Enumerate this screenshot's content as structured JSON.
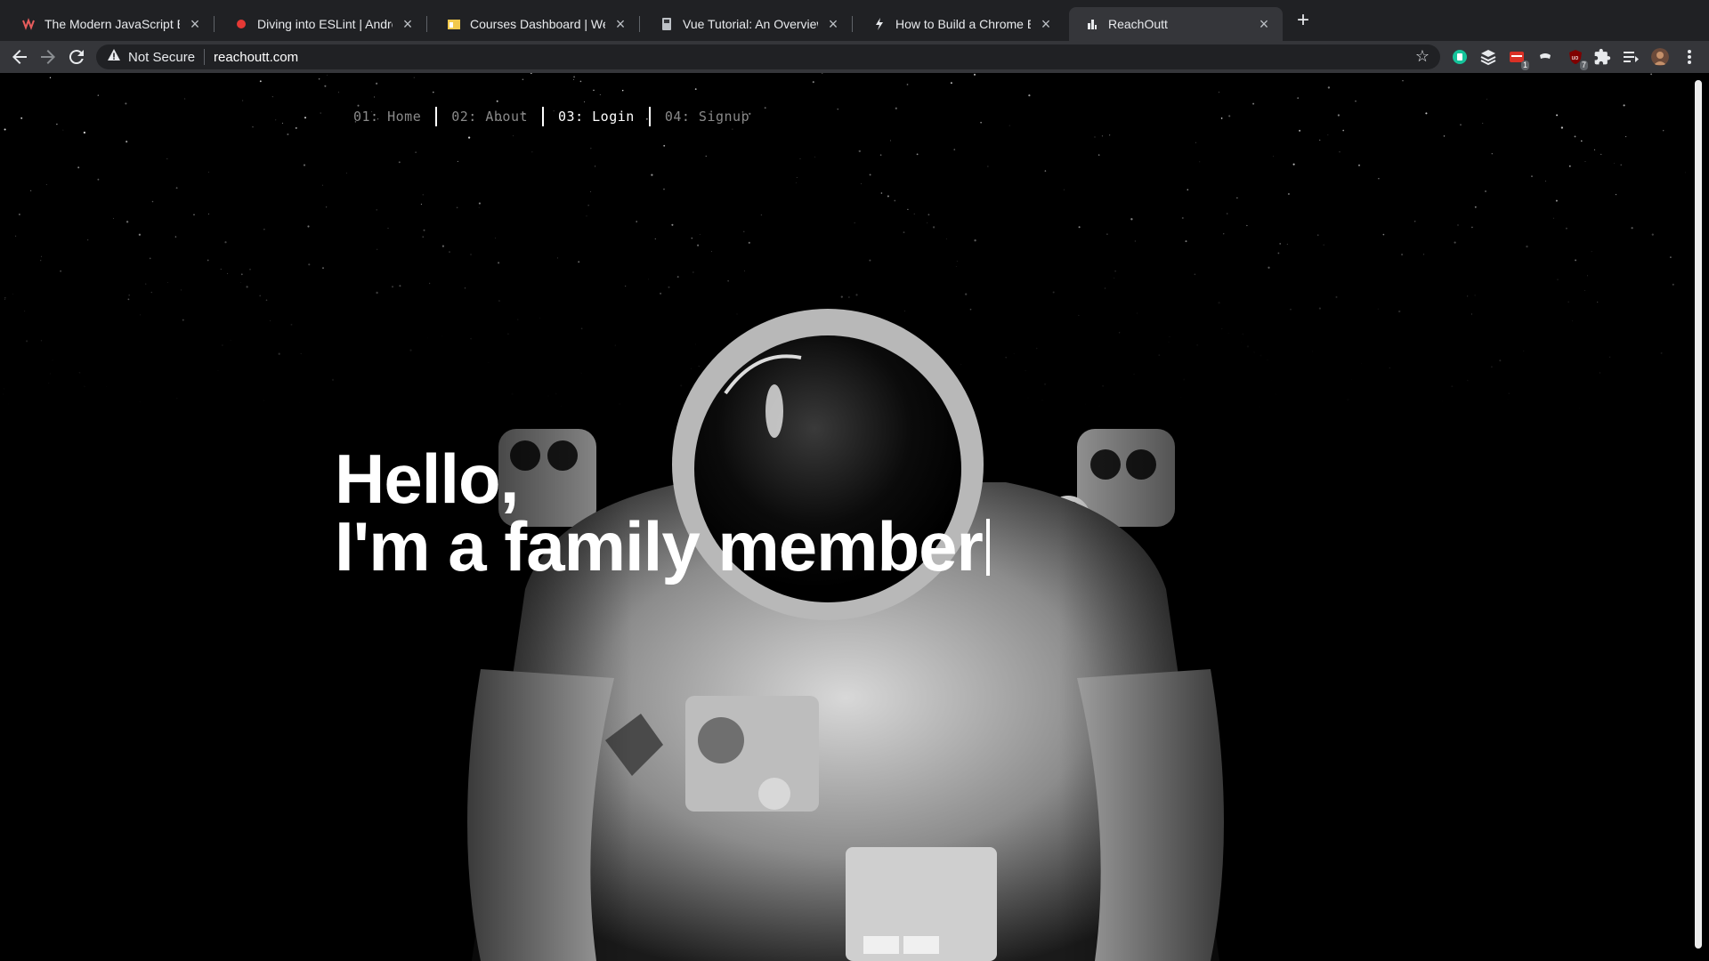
{
  "browser": {
    "tabs": [
      {
        "title": "The Modern JavaScript Bootcamp",
        "icon": "udemy-icon",
        "color": "#a435f0"
      },
      {
        "title": "Diving into ESLint | Andrew Mead",
        "icon": "red-dot-icon",
        "color": "#e53935"
      },
      {
        "title": "Courses Dashboard | Wes Bos",
        "icon": "wesbos-icon",
        "color": "#f2c94c"
      },
      {
        "title": "Vue Tutorial: An Overview and Walkthrough",
        "icon": "bookmark-icon",
        "color": "#9aa0a6"
      },
      {
        "title": "How to Build a Chrome Extension",
        "icon": "lightning-icon",
        "color": "#e8eaed"
      },
      {
        "title": "ReachOutt",
        "icon": "reachoutt-icon",
        "color": "#e8eaed"
      }
    ],
    "active_tab": 5,
    "security_label": "Not Secure",
    "url": "reachoutt.com",
    "extensions": [
      {
        "name": "grammarly-icon",
        "color": "#15c39a"
      },
      {
        "name": "layers-icon",
        "color": "#e8eaed"
      },
      {
        "name": "calendar-icon",
        "color": "#d93025",
        "badge": "1"
      },
      {
        "name": "mask-icon",
        "color": "#e8eaed"
      },
      {
        "name": "ublock-icon",
        "color": "#800000",
        "badge": "7"
      },
      {
        "name": "puzzle-icon",
        "color": "#e8eaed"
      },
      {
        "name": "reading-list-icon",
        "color": "#e8eaed"
      },
      {
        "name": "profile-avatar",
        "color": "#b07a5a"
      }
    ]
  },
  "site": {
    "nav": [
      {
        "label": "01: Home"
      },
      {
        "label": "02: About"
      },
      {
        "label": "03: Login"
      },
      {
        "label": "04: Signup"
      }
    ],
    "active_nav": 2,
    "hero": {
      "line1": "Hello,",
      "line2": "I'm a family member"
    },
    "colors": {
      "background": "#000000",
      "nav_inactive": "#8a8a8a",
      "nav_active": "#ffffff"
    }
  }
}
